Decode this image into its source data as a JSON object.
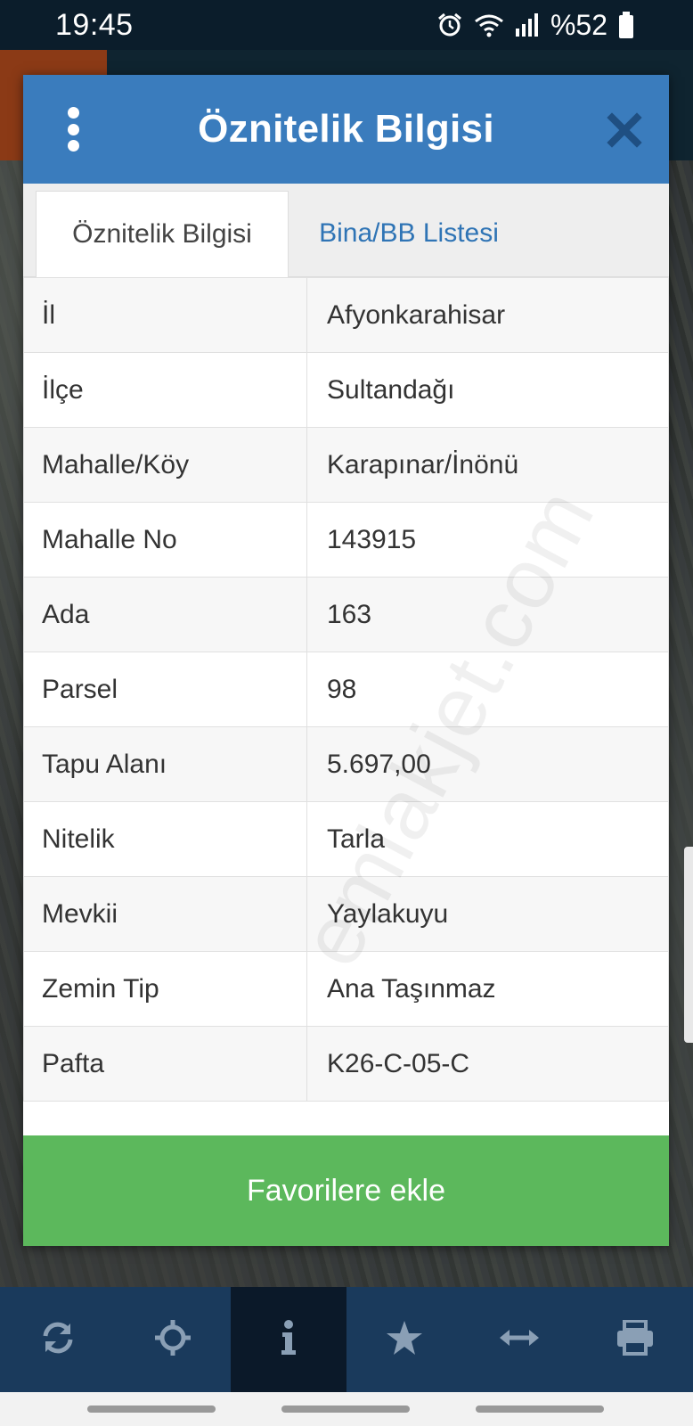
{
  "status_bar": {
    "time": "19:45",
    "battery": "%52",
    "icons": [
      "alarm-icon",
      "wifi-icon",
      "signal-icon",
      "battery-icon"
    ]
  },
  "dialog": {
    "title": "Öznitelik Bilgisi",
    "tabs": [
      {
        "label": "Öznitelik Bilgisi",
        "active": true
      },
      {
        "label": "Bina/BB Listesi",
        "active": false
      }
    ],
    "rows": [
      {
        "key": "İl",
        "value": "Afyonkarahisar"
      },
      {
        "key": "İlçe",
        "value": "Sultandağı"
      },
      {
        "key": "Mahalle/Köy",
        "value": "Karapınar/İnönü"
      },
      {
        "key": "Mahalle No",
        "value": "143915"
      },
      {
        "key": "Ada",
        "value": "163"
      },
      {
        "key": "Parsel",
        "value": "98"
      },
      {
        "key": "Tapu Alanı",
        "value": "5.697,00"
      },
      {
        "key": "Nitelik",
        "value": "Tarla"
      },
      {
        "key": "Mevkii",
        "value": "Yaylakuyu"
      },
      {
        "key": "Zemin Tip",
        "value": "Ana Taşınmaz"
      },
      {
        "key": "Pafta",
        "value": "K26-C-05-C"
      }
    ],
    "favorite_button": "Favorilere ekle",
    "watermark": "emlakjet.com"
  },
  "toolbar": {
    "items": [
      {
        "icon": "refresh-icon",
        "active": false
      },
      {
        "icon": "crosshair-icon",
        "active": false
      },
      {
        "icon": "info-icon",
        "active": true
      },
      {
        "icon": "star-icon",
        "active": false
      },
      {
        "icon": "measure-icon",
        "active": false
      },
      {
        "icon": "print-icon",
        "active": false
      }
    ]
  },
  "colors": {
    "header": "#3a7cbd",
    "favorite": "#5cb85c",
    "toolbar": "#1a3a5c",
    "tab_link": "#2f74b5"
  }
}
